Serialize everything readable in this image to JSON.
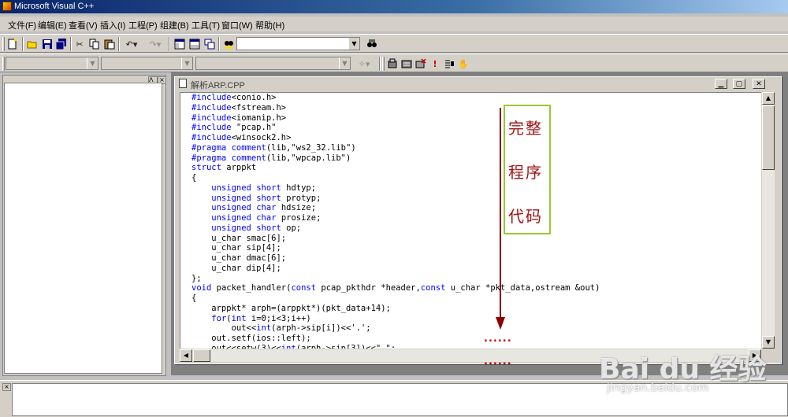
{
  "window": {
    "title": "Microsoft Visual C++"
  },
  "menu": {
    "items": [
      "文件(F)",
      "编辑(E)",
      "查看(V)",
      "插入(I)",
      "工程(P)",
      "组建(B)",
      "工具(T)",
      "窗口(W)",
      "帮助(H)"
    ]
  },
  "document": {
    "title": "解析ARP.CPP"
  },
  "code": {
    "lines": [
      [
        [
          "#include",
          "kw"
        ],
        [
          "<conio.h>",
          ""
        ]
      ],
      [
        [
          "#include",
          "kw"
        ],
        [
          "<fstream.h>",
          ""
        ]
      ],
      [
        [
          "#include",
          "kw"
        ],
        [
          "<iomanip.h>",
          ""
        ]
      ],
      [
        [
          "#include",
          "kw"
        ],
        [
          " \"pcap.h\"",
          ""
        ]
      ],
      [
        [
          "#include",
          "kw"
        ],
        [
          "<winsock2.h>",
          ""
        ]
      ],
      [
        [
          "#pragma",
          "kw"
        ],
        [
          " ",
          ""
        ],
        [
          "comment",
          "kw"
        ],
        [
          "(lib,\"ws2_32.lib\")",
          ""
        ]
      ],
      [
        [
          "#pragma",
          "kw"
        ],
        [
          " ",
          ""
        ],
        [
          "comment",
          "kw"
        ],
        [
          "(lib,\"wpcap.lib\")",
          ""
        ]
      ],
      [
        [
          "struct",
          "kw"
        ],
        [
          " arppkt",
          ""
        ]
      ],
      [
        [
          "{",
          ""
        ]
      ],
      [
        [
          "    ",
          ""
        ],
        [
          "unsigned",
          "kw"
        ],
        [
          " ",
          ""
        ],
        [
          "short",
          "kw"
        ],
        [
          " hdtyp;",
          ""
        ]
      ],
      [
        [
          "    ",
          ""
        ],
        [
          "unsigned",
          "kw"
        ],
        [
          " ",
          ""
        ],
        [
          "short",
          "kw"
        ],
        [
          " protyp;",
          ""
        ]
      ],
      [
        [
          "    ",
          ""
        ],
        [
          "unsigned",
          "kw"
        ],
        [
          " ",
          ""
        ],
        [
          "char",
          "kw"
        ],
        [
          " hdsize;",
          ""
        ]
      ],
      [
        [
          "    ",
          ""
        ],
        [
          "unsigned",
          "kw"
        ],
        [
          " ",
          ""
        ],
        [
          "char",
          "kw"
        ],
        [
          " prosize;",
          ""
        ]
      ],
      [
        [
          "    ",
          ""
        ],
        [
          "unsigned",
          "kw"
        ],
        [
          " ",
          ""
        ],
        [
          "short",
          "kw"
        ],
        [
          " op;",
          ""
        ]
      ],
      [
        [
          "    u_char smac[6];",
          ""
        ]
      ],
      [
        [
          "    u_char sip[4];",
          ""
        ]
      ],
      [
        [
          "    u_char dmac[6];",
          ""
        ]
      ],
      [
        [
          "    u_char dip[4];",
          ""
        ]
      ],
      [
        [
          "};",
          ""
        ]
      ],
      [
        [
          "void",
          "kw"
        ],
        [
          " packet_handler(",
          ""
        ],
        [
          "const",
          "kw"
        ],
        [
          " pcap_pkthdr *header,",
          ""
        ],
        [
          "const",
          "kw"
        ],
        [
          " u_char *pkt_data,ostream &out)",
          ""
        ]
      ],
      [
        [
          "{",
          ""
        ]
      ],
      [
        [
          "    arppkt* arph=(arppkt*)(pkt_data+14);",
          ""
        ]
      ],
      [
        [
          "    ",
          ""
        ],
        [
          "for",
          "kw"
        ],
        [
          "(",
          ""
        ],
        [
          "int",
          "kw"
        ],
        [
          " i=0;i<3;i++)",
          ""
        ]
      ],
      [
        [
          "        out<<",
          ""
        ],
        [
          "int",
          "kw"
        ],
        [
          "(arph->sip[i])<<'.';",
          ""
        ]
      ],
      [
        [
          "    out.setf(ios::left);",
          ""
        ]
      ],
      [
        [
          "    out<<setw(3)<<",
          ""
        ],
        [
          "int",
          "kw"
        ],
        [
          "(arph->sip[3])<<\" \";",
          ""
        ]
      ]
    ]
  },
  "annotation": {
    "lines": [
      "完整",
      "程序",
      "代码"
    ],
    "dots": "......",
    "color": "#a31515",
    "box_color": "#9bc832"
  },
  "watermark": {
    "logo": "Bai du 经验",
    "url": "jingyan.baidu.com"
  },
  "icons": [
    "new-file-icon",
    "open-icon",
    "save-icon",
    "save-all-icon",
    "cut-icon",
    "copy-icon",
    "paste-icon",
    "undo-icon",
    "redo-icon",
    "workspace-icon",
    "output-icon",
    "window-list-icon",
    "find-in-files-icon",
    "find-icon",
    "compile-icon",
    "build-icon",
    "stop-build-icon",
    "execute-icon",
    "insert-breakpoint-icon",
    "go-icon",
    "wizard-icon"
  ]
}
